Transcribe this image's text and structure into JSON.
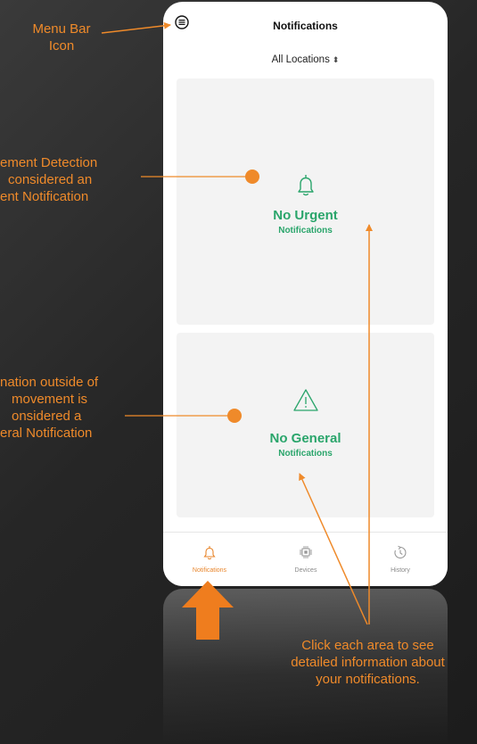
{
  "header": {
    "title": "Notifications"
  },
  "location_selector": {
    "label": "All Locations",
    "chevron": "⬍"
  },
  "cards": {
    "urgent": {
      "title": "No Urgent",
      "subtitle": "Notifications",
      "icon": "bell-icon"
    },
    "general": {
      "title": "No General",
      "subtitle": "Notifications",
      "icon": "warning-icon"
    }
  },
  "tabs": [
    {
      "label": "Notifications",
      "icon": "bell-icon",
      "active": true
    },
    {
      "label": "Devices",
      "icon": "chip-icon",
      "active": false
    },
    {
      "label": "History",
      "icon": "history-icon",
      "active": false
    }
  ],
  "annotations": {
    "menu_bar": [
      "Menu Bar",
      "Icon"
    ],
    "urgent": [
      "ement Detection",
      "considered an",
      "ent Notification"
    ],
    "general": [
      "nation outside of",
      "movement is",
      "onsidered a",
      "eral Notification"
    ],
    "click_area": [
      "Click each area to see",
      "detailed information about",
      "your notifications."
    ]
  },
  "colors": {
    "accent": "#2aa56b",
    "annotation": "#ef8a2a",
    "active_tab": "#e8852b"
  }
}
